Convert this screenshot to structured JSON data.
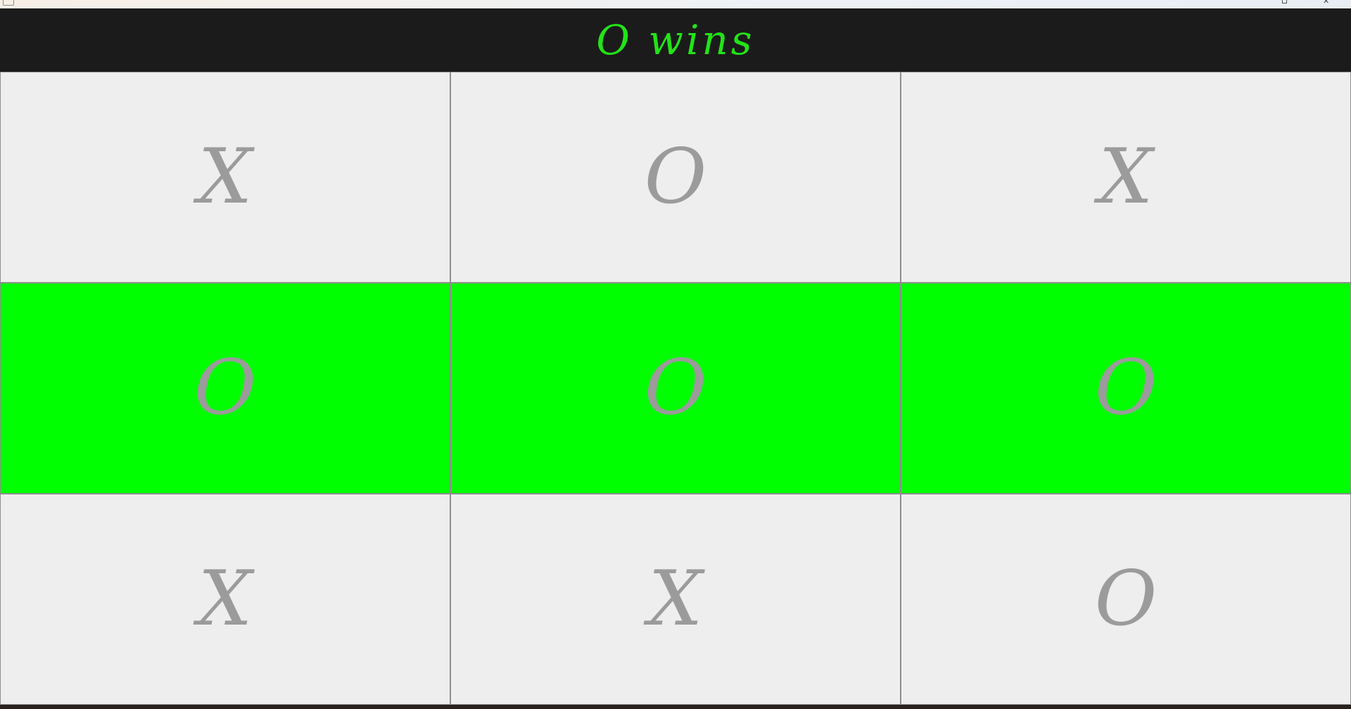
{
  "status": {
    "text": "O wins",
    "color": "#22e416"
  },
  "board": {
    "cell_color": "#eeeeee",
    "win_color": "#00ff00",
    "mark_color": "#9b9b9b",
    "cells": [
      {
        "mark": "X",
        "winning": false
      },
      {
        "mark": "O",
        "winning": false
      },
      {
        "mark": "X",
        "winning": false
      },
      {
        "mark": "O",
        "winning": true
      },
      {
        "mark": "O",
        "winning": true
      },
      {
        "mark": "O",
        "winning": true
      },
      {
        "mark": "X",
        "winning": false
      },
      {
        "mark": "X",
        "winning": false
      },
      {
        "mark": "O",
        "winning": false
      }
    ]
  },
  "window": {
    "icons": [
      "app-icon",
      "restore-icon",
      "close-icon"
    ],
    "close_glyph": "✕"
  }
}
